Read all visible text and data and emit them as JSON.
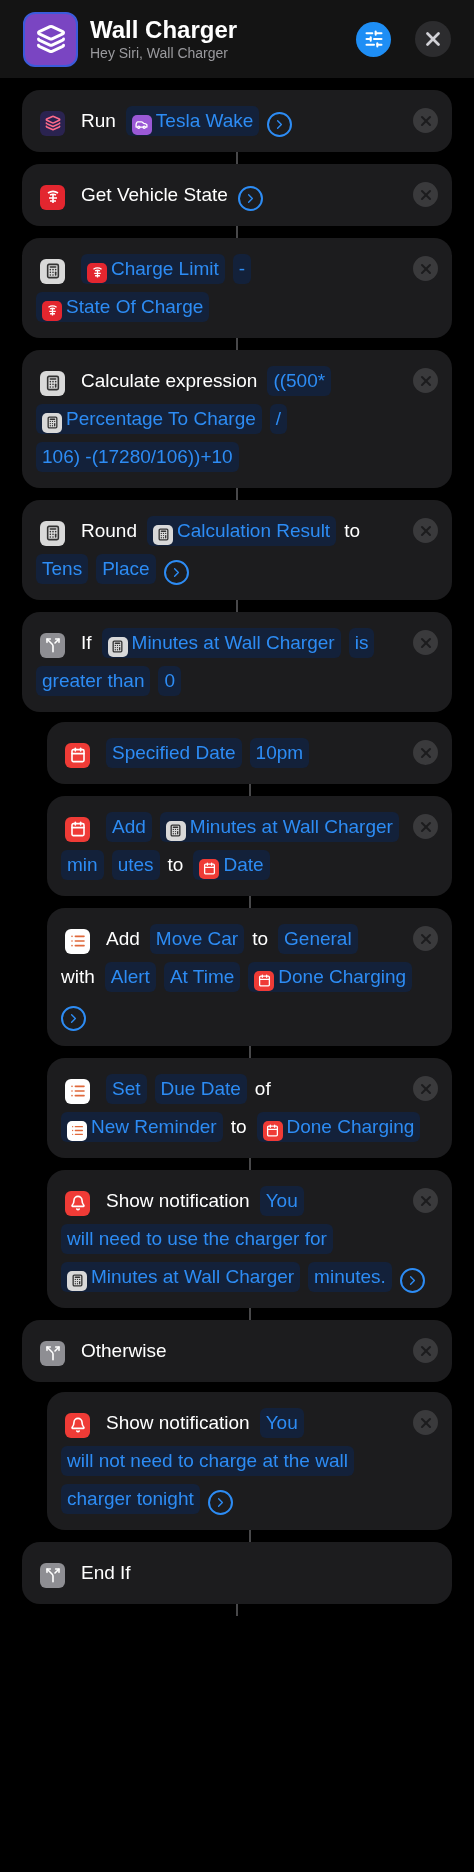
{
  "header": {
    "title": "Wall Charger",
    "subtitle": "Hey Siri, Wall Charger"
  },
  "actions": [
    {
      "kind": "shortcuts",
      "removable": true,
      "parts": [
        {
          "kind": "text",
          "text": "Run"
        },
        {
          "kind": "car",
          "text": "Tesla Wake"
        },
        {
          "kind": "more"
        }
      ]
    },
    {
      "kind": "tesla",
      "removable": true,
      "parts": [
        {
          "kind": "text",
          "text": "Get Vehicle State"
        },
        {
          "kind": "more"
        }
      ]
    },
    {
      "kind": "calculator",
      "removable": true,
      "parts": [
        {
          "kind": "tesla",
          "text": "Charge Limit"
        },
        {
          "kind": "token",
          "text": "-"
        },
        {
          "kind": "tesla",
          "text": "State Of Charge"
        }
      ]
    },
    {
      "kind": "calculator",
      "removable": true,
      "parts": [
        {
          "kind": "text",
          "text": "Calculate expression"
        },
        {
          "kind": "token",
          "text": "((500*"
        },
        {
          "kind": "calculator",
          "text": "Percentage To Charge"
        },
        {
          "kind": "token",
          "text": "/"
        },
        {
          "kind": "token",
          "text": "106) -(17280/106))+10"
        }
      ]
    },
    {
      "kind": "calculator",
      "removable": true,
      "parts": [
        {
          "kind": "text",
          "text": "Round"
        },
        {
          "kind": "calculator",
          "text": "Calculation Result"
        },
        {
          "kind": "text",
          "text": "to"
        },
        {
          "kind": "token",
          "text": "Tens"
        },
        {
          "kind": "token",
          "text": "Place"
        },
        {
          "kind": "more"
        }
      ]
    },
    {
      "kind": "scripting",
      "removable": true,
      "parts": [
        {
          "kind": "text",
          "text": "If"
        },
        {
          "kind": "calculator",
          "text": "Minutes at Wall Charger"
        },
        {
          "kind": "token",
          "text": "is"
        },
        {
          "kind": "token",
          "text": "greater than"
        },
        {
          "kind": "token",
          "text": "0"
        }
      ],
      "children": [
        {
          "kind": "calendar",
          "removable": true,
          "parts": [
            {
              "kind": "token",
              "text": "Specified Date"
            },
            {
              "kind": "token",
              "text": "10pm"
            }
          ]
        },
        {
          "kind": "calendar",
          "removable": true,
          "parts": [
            {
              "kind": "token",
              "text": "Add"
            },
            {
              "kind": "calculator",
              "text": "Minutes at Wall Charger"
            },
            {
              "kind": "token",
              "text": "min"
            },
            {
              "kind": "token",
              "text": "utes"
            },
            {
              "kind": "text",
              "text": "to"
            },
            {
              "kind": "calendar",
              "text": "Date"
            }
          ]
        },
        {
          "kind": "reminders",
          "removable": true,
          "parts": [
            {
              "kind": "text",
              "text": "Add"
            },
            {
              "kind": "token",
              "text": "Move Car"
            },
            {
              "kind": "text",
              "text": "to"
            },
            {
              "kind": "token",
              "text": "General"
            },
            {
              "kind": "text",
              "text": "with"
            },
            {
              "kind": "token",
              "text": "Alert"
            },
            {
              "kind": "token",
              "text": "At Time"
            },
            {
              "kind": "calendar",
              "text": "Done Charging"
            },
            {
              "kind": "more"
            }
          ]
        },
        {
          "kind": "reminders",
          "removable": true,
          "parts": [
            {
              "kind": "token",
              "text": "Set"
            },
            {
              "kind": "token",
              "text": "Due Date"
            },
            {
              "kind": "text",
              "text": "of"
            },
            {
              "kind": "reminders",
              "text": "New Reminder"
            },
            {
              "kind": "text",
              "text": "to"
            },
            {
              "kind": "calendar",
              "text": "Done Charging"
            }
          ]
        },
        {
          "kind": "notification",
          "removable": true,
          "parts": [
            {
              "kind": "text",
              "text": "Show notification"
            },
            {
              "kind": "token",
              "text": "You"
            },
            {
              "kind": "token",
              "text": "will need to use the charger for"
            },
            {
              "kind": "calculator",
              "text": "Minutes at Wall Charger"
            },
            {
              "kind": "token",
              "text": "minutes."
            },
            {
              "kind": "more"
            }
          ]
        }
      ]
    },
    {
      "kind": "scripting",
      "removable": true,
      "parts": [
        {
          "kind": "text",
          "text": "Otherwise"
        }
      ],
      "children": [
        {
          "kind": "notification",
          "removable": true,
          "parts": [
            {
              "kind": "text",
              "text": "Show notification"
            },
            {
              "kind": "token",
              "text": "You"
            },
            {
              "kind": "token",
              "text": "will not need to charge at the wall"
            },
            {
              "kind": "token",
              "text": "charger tonight"
            },
            {
              "kind": "more"
            }
          ]
        }
      ]
    },
    {
      "kind": "scripting",
      "removable": false,
      "parts": [
        {
          "kind": "text",
          "text": "End If"
        }
      ]
    }
  ]
}
